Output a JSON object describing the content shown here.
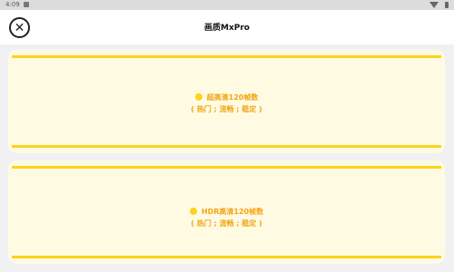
{
  "status_bar": {
    "time": "4:09"
  },
  "header": {
    "title": "画质MxPro",
    "close_icon": "close-circle-icon"
  },
  "cards": [
    {
      "title": "超高清120帧数",
      "subtitle": "( 热门 ; 流畅 ; 稳定 )"
    },
    {
      "title": "HDR高清120帧数",
      "subtitle": "( 热门 ; 流畅 ; 稳定 )"
    }
  ],
  "colors": {
    "accent_yellow": "#ffd21c",
    "label_orange": "#f3a513",
    "card_bg": "#fffbe3",
    "page_bg": "#f1f0f3"
  }
}
